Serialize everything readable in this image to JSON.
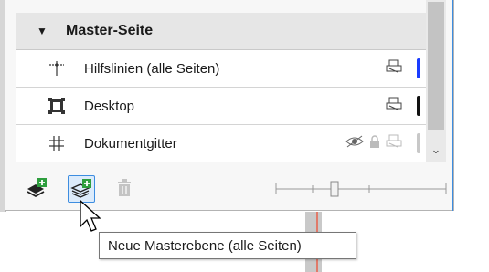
{
  "panel": {
    "group": {
      "toggle": "▼",
      "name": "Master-Seite"
    },
    "layers": [
      {
        "name": "Hilfslinien (alle Seiten)",
        "icon": "guidelines-icon",
        "visible": false,
        "locked": false,
        "printable": true,
        "color": "#1a3cff"
      },
      {
        "name": "Desktop",
        "icon": "desktop-icon",
        "visible": false,
        "locked": false,
        "printable": true,
        "color": "#111111"
      },
      {
        "name": "Dokumentgitter",
        "icon": "grid-icon",
        "visible": true,
        "locked": true,
        "printable": true,
        "color": "#c8c8c8"
      }
    ],
    "scroll_down": "⌄"
  },
  "toolbar": {
    "buttons": [
      {
        "name": "new-layer-button",
        "icon": "new-layer-icon"
      },
      {
        "name": "new-master-layer-all-pages-button",
        "icon": "new-master-layer-icon",
        "active": true
      },
      {
        "name": "delete-layer-button",
        "icon": "trash-icon",
        "disabled": true
      }
    ]
  },
  "tooltip": {
    "text": "Neue Masterebene (alle Seiten)"
  },
  "colors": {
    "accent": "#3d8de0",
    "guideline_layer": "#1a3cff",
    "desktop_layer": "#111111",
    "grid_layer": "#c8c8c8"
  }
}
